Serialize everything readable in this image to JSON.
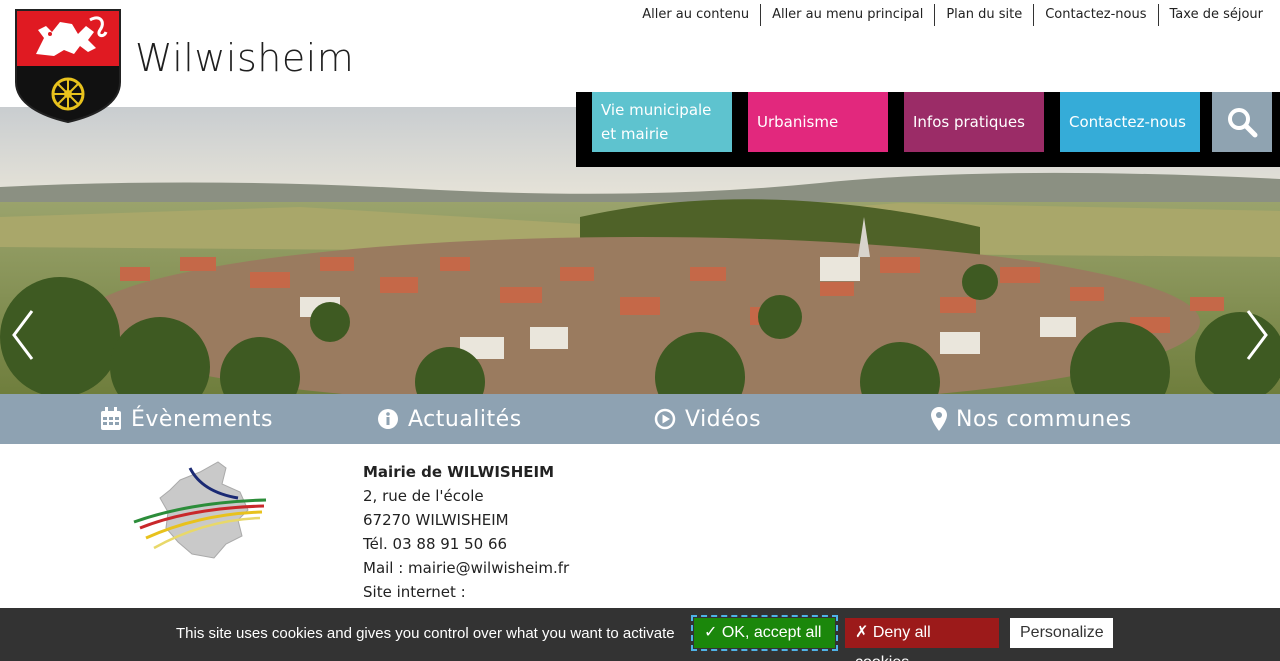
{
  "site": {
    "title": "Wilwisheim"
  },
  "top_links": [
    {
      "label": "Aller au contenu"
    },
    {
      "label": "Aller au menu principal"
    },
    {
      "label": "Plan du site"
    },
    {
      "label": "Contactez-nous"
    },
    {
      "label": "Taxe de séjour"
    }
  ],
  "main_nav": {
    "items": [
      {
        "label": "Vie municipale et mairie",
        "color": "#5ec3cf"
      },
      {
        "label": "Urbanisme",
        "color": "#e2287d"
      },
      {
        "label": "Infos pratiques",
        "color": "#9b2c67"
      },
      {
        "label": "Contactez-nous",
        "color": "#35acd8"
      }
    ],
    "search_icon": "search-icon"
  },
  "carousel": {
    "prev_icon": "chevron-left-icon",
    "next_icon": "chevron-right-icon"
  },
  "quick_links": [
    {
      "label": "Évènements",
      "icon": "calendar-icon"
    },
    {
      "label": "Actualités",
      "icon": "info-circle-icon"
    },
    {
      "label": "Vidéos",
      "icon": "play-circle-icon"
    },
    {
      "label": "Nos communes",
      "icon": "map-marker-icon"
    }
  ],
  "contact": {
    "name": "Mairie de WILWISHEIM",
    "street": "2, rue de l'école",
    "city": "67270 WILWISHEIM",
    "phone": "Tél. 03 88 91 50 66",
    "mail": "Mail : mairie@wilwisheim.fr",
    "website": "Site internet :"
  },
  "cookie_banner": {
    "text": "This site uses cookies and gives you control over what you want to activate",
    "accept_label": "✓ OK, accept all",
    "deny_label": "✗ Deny all cookies",
    "personalize_label": "Personalize"
  },
  "colors": {
    "quick_bar": "#8ea2b2",
    "cookie_bg": "#333333",
    "accept": "#1b870b",
    "deny": "#9c1a1a"
  }
}
